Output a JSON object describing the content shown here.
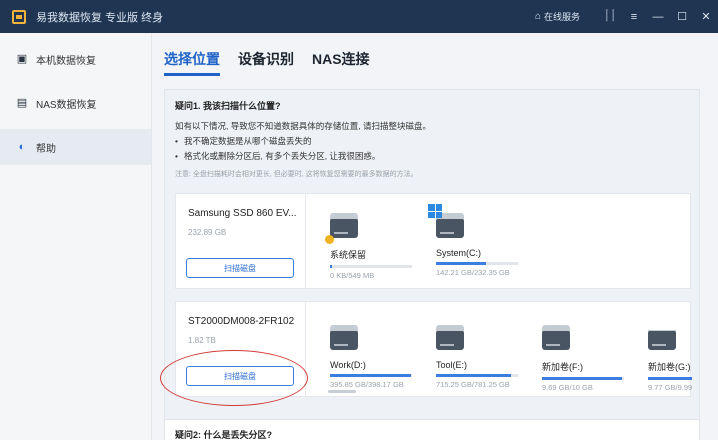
{
  "app": {
    "title": "易我数据恢复 专业版 终身",
    "login_label": "在线服务",
    "controls": [
      "⏐⏐",
      "≡",
      "—",
      "☐",
      "✕"
    ]
  },
  "sidebar": {
    "items": [
      {
        "label": "本机数据恢复",
        "icon": "local-disk-icon"
      },
      {
        "label": "NAS数据恢复",
        "icon": "nas-icon"
      },
      {
        "label": "帮助",
        "icon": "help-icon"
      }
    ]
  },
  "tabs": [
    {
      "label": "选择位置",
      "active": true
    },
    {
      "label": "设备识别",
      "active": false
    },
    {
      "label": "NAS连接",
      "active": false
    }
  ],
  "faq": {
    "q1_title": "疑问1. 我该扫描什么位置?",
    "q1_desc": "如有以下情况, 导致您不知道数据具体的存储位置, 请扫描整块磁盘。",
    "bullets": [
      "我不确定数据是从哪个磁盘丢失的",
      "格式化或删除分区后, 有多个丢失分区, 让我很困惑。"
    ],
    "note": "注意: 全盘扫描耗时会相对更长, 但必要时, 这将恢复您需要的最多数据的方法。",
    "q2_title": "疑问2: 什么是丢失分区?"
  },
  "disks": [
    {
      "name": "Samsung SSD 860 EV...",
      "size": "232.89 GB",
      "scan_label": "扫描磁盘",
      "partitions": [
        {
          "label": "系统保留",
          "size": "0 KB/549 MB",
          "fill": 0.02,
          "icon": "system-reserved-drive-icon"
        },
        {
          "label": "System(C:)",
          "size": "142.21 GB/232.35 GB",
          "fill": 0.61,
          "icon": "windows-drive-icon"
        }
      ]
    },
    {
      "name": "ST2000DM008-2FR102",
      "size": "1.82 TB",
      "scan_label": "扫描磁盘",
      "partitions": [
        {
          "label": "Work(D:)",
          "size": "395.85 GB/398.17 GB",
          "fill": 0.99,
          "icon": "drive-icon"
        },
        {
          "label": "Tool(E:)",
          "size": "715.25 GB/781.25 GB",
          "fill": 0.92,
          "icon": "drive-icon"
        },
        {
          "label": "新加卷(F:)",
          "size": "9.69 GB/10 GB",
          "fill": 0.97,
          "icon": "drive-icon"
        },
        {
          "label": "新加卷(G:)",
          "size": "9.77 GB/9.99 GB",
          "fill": 0.98,
          "icon": "drive-icon"
        }
      ]
    }
  ]
}
